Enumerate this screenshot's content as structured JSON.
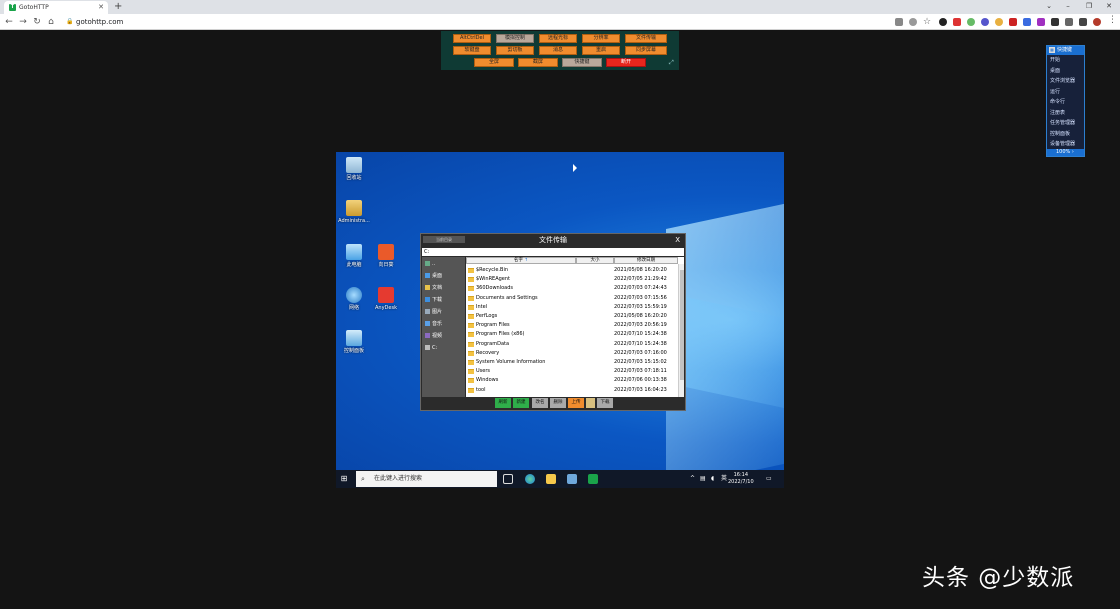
{
  "browser": {
    "tab_title": "GotoHTTP",
    "tab_favicon": "T",
    "url": "gotohttp.com",
    "icons": [
      "back-icon",
      "forward-icon",
      "reload-icon",
      "home-icon",
      "lock-icon",
      "new-tab-icon",
      "close-tab-icon",
      "minimize-icon",
      "restore-icon",
      "close-window-icon",
      "menu-icon"
    ]
  },
  "control_bar": {
    "row1": [
      "AltCtrlDel",
      "模拟控制",
      "远程光标",
      "分辨率",
      "文件传输"
    ],
    "row2": [
      "软键盘",
      "剪切板",
      "消息",
      "重启",
      "同步屏幕"
    ],
    "row3": [
      "全屏",
      "截屏",
      "快捷键",
      "断开"
    ],
    "colors": {
      "bar": "#0f3a34",
      "button": "#f08c2e",
      "gray": "#b9a89b",
      "disconnect": "#e8261d"
    }
  },
  "shortcut_menu": {
    "title": "快捷键",
    "items": [
      "开始",
      "桌面",
      "文件浏览器",
      "运行",
      "命令行",
      "注册表",
      "任务管理器",
      "控制面板",
      "设备管理器"
    ],
    "zoom": "100%"
  },
  "desktop": {
    "icons": {
      "recycle": "回收站",
      "admin": "Administra...",
      "pc": "此电脑",
      "xrk": "向日葵",
      "network": "网络",
      "anydesk": "AnyDesk",
      "control": "控制面板"
    }
  },
  "taskbar": {
    "search_placeholder": "在此键入进行搜索",
    "time": "16:14",
    "date": "2022/7/10",
    "lang": "英",
    "tray_arrow": "^"
  },
  "file_transfer": {
    "title": "文件传输",
    "close": "X",
    "tag": "当前目录",
    "path": "C:",
    "sidebar": [
      "..",
      "桌面",
      "文档",
      "下载",
      "图片",
      "音乐",
      "视频",
      "C:"
    ],
    "columns": {
      "name": "名字",
      "size": "大小",
      "date": "修改日期"
    },
    "rows": [
      {
        "name": "$Recycle.Bin",
        "date": "2021/05/08 16:20:20"
      },
      {
        "name": "$WinREAgent",
        "date": "2022/07/05 21:29:42"
      },
      {
        "name": "360Downloads",
        "date": "2022/07/03 07:24:43"
      },
      {
        "name": "Documents and Settings",
        "date": "2022/07/03 07:15:56"
      },
      {
        "name": "Intel",
        "date": "2022/07/03 15:59:19"
      },
      {
        "name": "PerfLogs",
        "date": "2021/05/08 16:20:20"
      },
      {
        "name": "Program Files",
        "date": "2022/07/03 20:56:19"
      },
      {
        "name": "Program Files (x86)",
        "date": "2022/07/10 15:24:38"
      },
      {
        "name": "ProgramData",
        "date": "2022/07/10 15:24:38"
      },
      {
        "name": "Recovery",
        "date": "2022/07/03 07:16:00"
      },
      {
        "name": "System Volume Information",
        "date": "2022/07/03 15:15:02"
      },
      {
        "name": "Users",
        "date": "2022/07/03 07:18:11"
      },
      {
        "name": "Windows",
        "date": "2022/07/06 00:13:38"
      },
      {
        "name": "tool",
        "date": "2022/07/03 16:04:23"
      }
    ],
    "actions": [
      "刷新",
      "新建",
      "改名",
      "删除",
      "上传",
      "下载"
    ]
  },
  "watermark": "头条 @少数派"
}
